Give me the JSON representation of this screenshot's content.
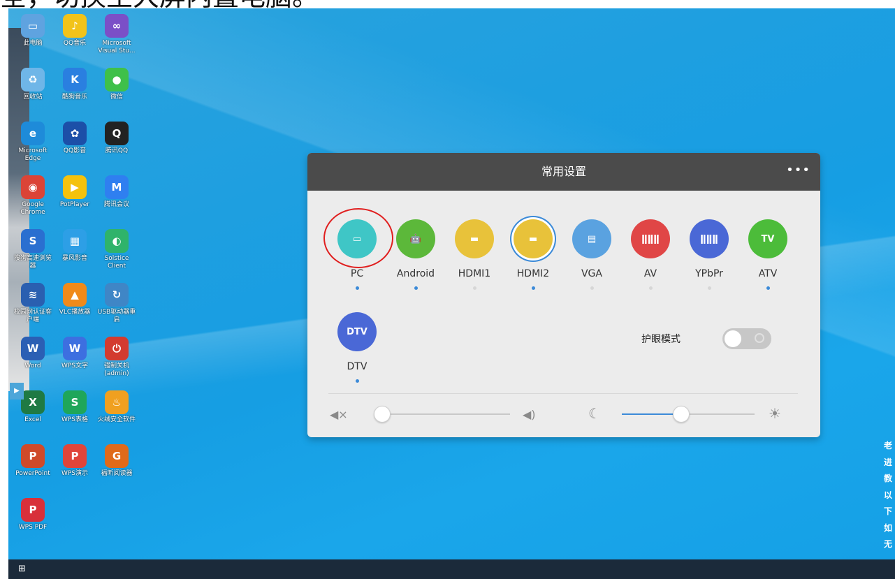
{
  "overlay_caption": "全，切换至大屏内置电脑。",
  "desktop_icons": [
    {
      "name": "此电脑",
      "color": "#5fa3e0",
      "glyph": "▭"
    },
    {
      "name": "QQ音乐",
      "color": "#f2c31a",
      "glyph": "♪"
    },
    {
      "name": "Microsoft Visual Stu...",
      "color": "#7b4fc7",
      "glyph": "∞"
    },
    {
      "name": "回收站",
      "color": "#6fb6e8",
      "glyph": "♻"
    },
    {
      "name": "酷狗音乐",
      "color": "#2a7fe0",
      "glyph": "K"
    },
    {
      "name": "微信",
      "color": "#3fc04a",
      "glyph": "●"
    },
    {
      "name": "Microsoft Edge",
      "color": "#1e8bd9",
      "glyph": "e"
    },
    {
      "name": "QQ影音",
      "color": "#1c4fa8",
      "glyph": "✿"
    },
    {
      "name": "腾讯QQ",
      "color": "#222222",
      "glyph": "Q"
    },
    {
      "name": "Google Chrome",
      "color": "#db4437",
      "glyph": "◉"
    },
    {
      "name": "PotPlayer",
      "color": "#f4c20d",
      "glyph": "▶"
    },
    {
      "name": "腾讯会议",
      "color": "#2f7ff0",
      "glyph": "M"
    },
    {
      "name": "搜狗高速浏览器",
      "color": "#2a6fd0",
      "glyph": "S"
    },
    {
      "name": "暴风影音",
      "color": "#2d9fe6",
      "glyph": "▦"
    },
    {
      "name": "Solstice Client",
      "color": "#2fb36a",
      "glyph": "◐"
    },
    {
      "name": "校园网认证客户端",
      "color": "#2a5fb0",
      "glyph": "≋"
    },
    {
      "name": "VLC播放器",
      "color": "#f08a1a",
      "glyph": "▲"
    },
    {
      "name": "USB驱动器重启",
      "color": "#3f86c6",
      "glyph": "↻"
    },
    {
      "name": "Word",
      "color": "#2b5fb4",
      "glyph": "W"
    },
    {
      "name": "WPS文字",
      "color": "#3d6fe0",
      "glyph": "W"
    },
    {
      "name": "强制关机(admin)",
      "color": "#d33b2f",
      "glyph": "⏻"
    },
    {
      "name": "Excel",
      "color": "#1f7a44",
      "glyph": "X"
    },
    {
      "name": "WPS表格",
      "color": "#1fa65a",
      "glyph": "S"
    },
    {
      "name": "火绒安全软件",
      "color": "#f0a020",
      "glyph": "♨"
    },
    {
      "name": "PowerPoint",
      "color": "#cf4a2a",
      "glyph": "P"
    },
    {
      "name": "WPS演示",
      "color": "#e0453a",
      "glyph": "P"
    },
    {
      "name": "福昕阅读器",
      "color": "#e06a1a",
      "glyph": "G"
    },
    {
      "name": "WPS PDF",
      "color": "#d8303a",
      "glyph": "P"
    }
  ],
  "side_text": [
    "老",
    "进",
    "教",
    "以",
    "下",
    "如",
    "无"
  ],
  "panel": {
    "title": "常用设置",
    "more": "•••",
    "sources": [
      {
        "name": "PC",
        "color": "#3fc6c6",
        "glyph": "▭",
        "active": true
      },
      {
        "name": "Android",
        "color": "#5cb83a",
        "glyph": "🤖",
        "active": true
      },
      {
        "name": "HDMI1",
        "color": "#e8c23a",
        "glyph": "▬",
        "active": false
      },
      {
        "name": "HDMI2",
        "color": "#e8c23a",
        "glyph": "▬",
        "active": true
      },
      {
        "name": "VGA",
        "color": "#5aa2e0",
        "glyph": "▤",
        "active": false
      },
      {
        "name": "AV",
        "color": "#e04646",
        "glyph": "ǁǁǁ",
        "active": false
      },
      {
        "name": "YPbPr",
        "color": "#4a68d6",
        "glyph": "ǁǁǁ",
        "active": false
      },
      {
        "name": "ATV",
        "color": "#4cbc3a",
        "glyph": "TV",
        "active": true
      },
      {
        "name": "DTV",
        "color": "#4a68d6",
        "glyph": "DTV",
        "active": true
      }
    ],
    "eye_care_label": "护眼模式",
    "eye_care_on": false,
    "volume_level": 0.03,
    "brightness_level": 0.44,
    "icons": {
      "mute": "speaker-muted-icon",
      "volume": "speaker-icon",
      "dark": "moon-icon",
      "bright": "sun-icon"
    },
    "colors": {
      "accent": "#3b8ad8",
      "header": "#4b4b4b",
      "highlight_ring": "#e01e1e"
    }
  }
}
